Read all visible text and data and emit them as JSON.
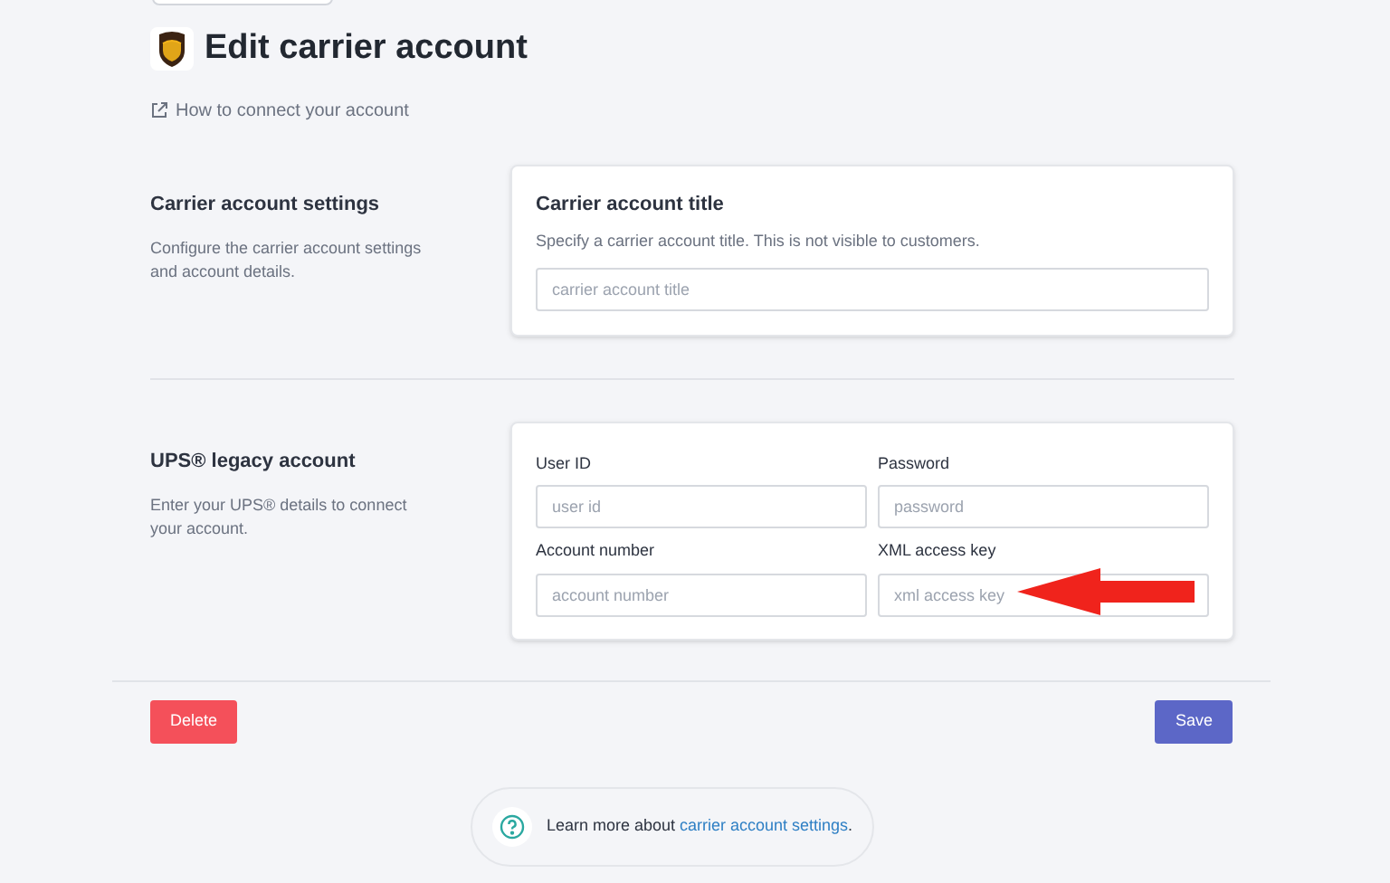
{
  "header": {
    "title": "Edit carrier account",
    "help_link": "How to connect your account"
  },
  "sections": [
    {
      "heading": "Carrier account settings",
      "description": "Configure the carrier account settings and account details.",
      "card_title": "Carrier account title",
      "card_hint": "Specify a carrier account title. This is not visible to customers.",
      "fields": [
        {
          "placeholder": "carrier account title"
        }
      ]
    },
    {
      "heading": "UPS® legacy account",
      "description": "Enter your UPS® details to connect your account.",
      "fields": [
        {
          "label": "User ID",
          "placeholder": "user id"
        },
        {
          "label": "Password",
          "placeholder": "password"
        },
        {
          "label": "Account number",
          "placeholder": "account number"
        },
        {
          "label": "XML access key",
          "placeholder": "xml access key",
          "annotated": true
        }
      ]
    }
  ],
  "buttons": [
    {
      "kind": "danger",
      "label": "Delete"
    },
    {
      "kind": "primary",
      "label": "Save"
    }
  ],
  "help": {
    "text": "Learn more about ",
    "link": "carrier account settings",
    "suffix": "."
  }
}
